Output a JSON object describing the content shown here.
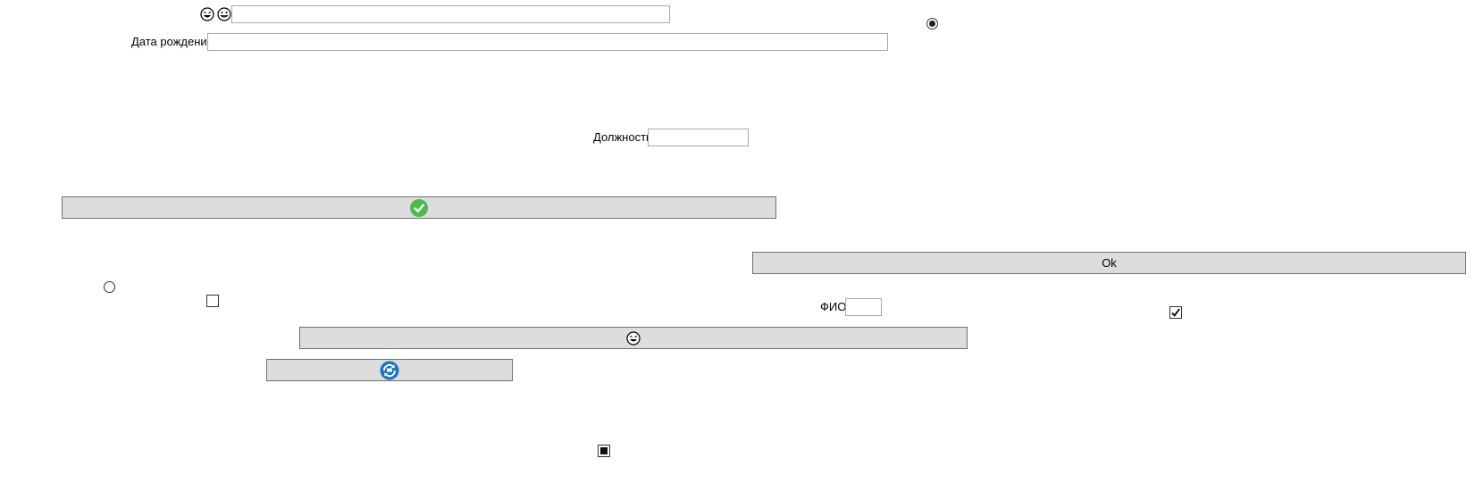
{
  "form": {
    "birth_date_label": "Дата рождения",
    "position_label": "Должность",
    "fio_label": "ФИО",
    "birth_date_value": "",
    "position_value": "",
    "fio_value": "",
    "top_field_value": ""
  },
  "buttons": {
    "ok_label": "Ok"
  },
  "icons": {
    "top_icon_1": "laughing-face-icon",
    "top_icon_2": "smiling-face-icon",
    "check_button_icon": "green-check-icon",
    "emoji_button_icon": "laughing-face-icon",
    "refresh_button_icon": "blue-refresh-icon"
  },
  "controls": {
    "radio_top": {
      "checked": true
    },
    "radio_left": {
      "checked": false
    },
    "checkbox_left": {
      "checked": false
    },
    "checkbox_right": {
      "checked": true
    },
    "checkbox_bottom": {
      "state": "indeterminate"
    }
  },
  "colors": {
    "button_bg": "#dddddd",
    "check_icon": "#4cbb4c",
    "refresh_icon": "#1a73c8"
  }
}
